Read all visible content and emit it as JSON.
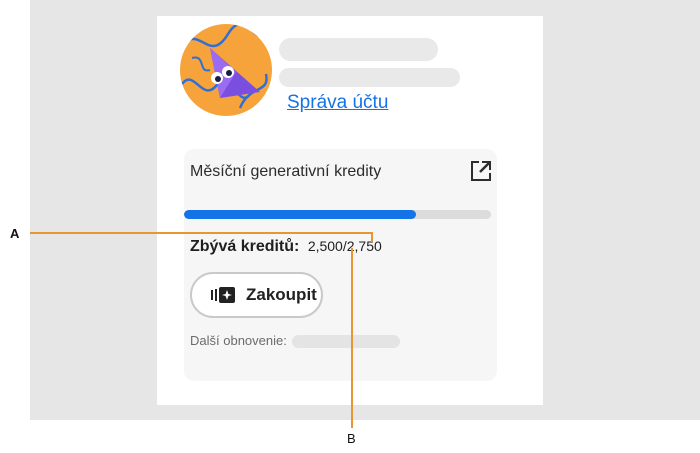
{
  "profile": {
    "account_link": "Správa účtu"
  },
  "credits": {
    "title": "Měsíční generativní kredity",
    "remaining_label": "Zbývá kreditů:",
    "remaining_value": "2,500/2,750",
    "progress_fraction": 0.755,
    "buy_label": "Zakoupit",
    "renewal_label": "Další obnovenie:"
  },
  "callouts": {
    "a": "A",
    "b": "B"
  },
  "colors": {
    "accent": "#1473e6",
    "callout": "#e8962f",
    "avatar_bg": "#f5a33a",
    "avatar_shape": "#7a4fe0"
  }
}
